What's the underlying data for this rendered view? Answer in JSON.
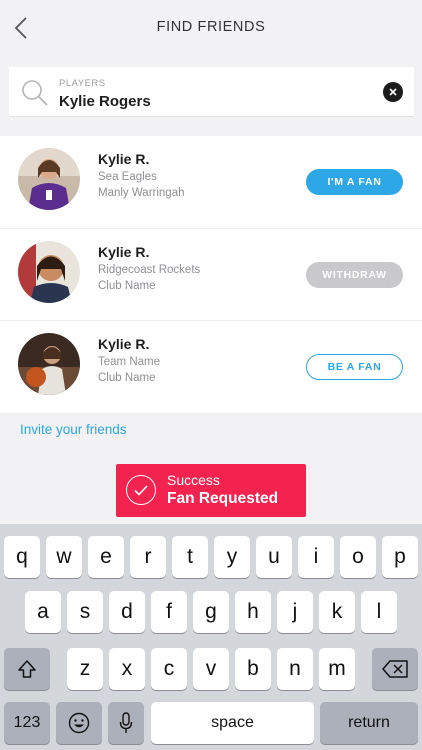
{
  "header": {
    "title": "FIND FRIENDS"
  },
  "search": {
    "label": "PLAYERS",
    "value": "Kylie Rogers"
  },
  "players": [
    {
      "name": "Kylie R.",
      "team": "Sea Eagles",
      "club": "Manly Warringah",
      "action": "I'M A FAN",
      "action_state": "fan"
    },
    {
      "name": "Kylie R.",
      "team": "Ridgecoast Rockets",
      "club": "Club Name",
      "action": "WITHDRAW",
      "action_state": "withdraw"
    },
    {
      "name": "Kylie R.",
      "team": "Team Name",
      "club": "Club Name",
      "action": "BE A FAN",
      "action_state": "befan"
    }
  ],
  "invite_link": "Invite your friends",
  "toast": {
    "title": "Success",
    "message": "Fan Requested"
  },
  "keyboard": {
    "row1": [
      "q",
      "w",
      "e",
      "r",
      "t",
      "y",
      "u",
      "i",
      "o",
      "p"
    ],
    "row2": [
      "a",
      "s",
      "d",
      "f",
      "g",
      "h",
      "j",
      "k",
      "l"
    ],
    "row3": [
      "z",
      "x",
      "c",
      "v",
      "b",
      "n",
      "m"
    ],
    "numbers_key": "123",
    "space_key": "space",
    "return_key": "return"
  },
  "colors": {
    "accent": "#2da7e6",
    "toast": "#f2234e",
    "withdraw": "#c9c9cc"
  }
}
